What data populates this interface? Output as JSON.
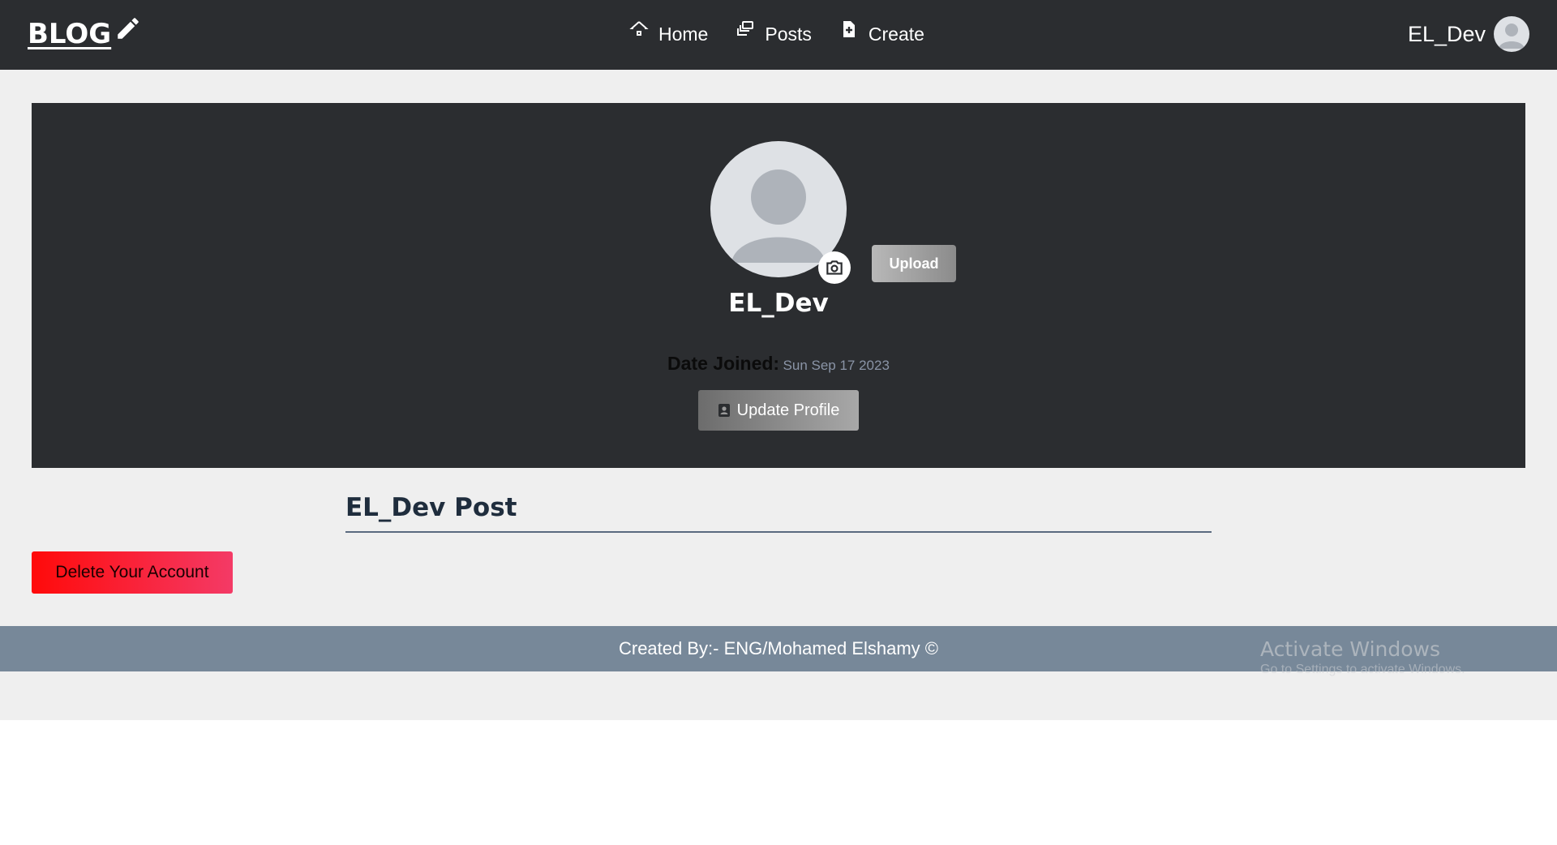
{
  "navbar": {
    "brand_label": "BLOG",
    "brand_icon": "pencil-icon",
    "links": [
      {
        "label": "Home",
        "icon": "home-icon"
      },
      {
        "label": "Posts",
        "icon": "posts-icon"
      },
      {
        "label": "Create",
        "icon": "create-file-icon"
      }
    ],
    "user_name": "EL_Dev",
    "user_avatar_icon": "user-avatar-icon"
  },
  "profile": {
    "name": "EL_Dev",
    "avatar_icon": "user-avatar-icon",
    "camera_icon": "camera-icon",
    "upload_label": "Upload",
    "date_joined_label": "Date Joined:",
    "date_joined_value": "Sun Sep 17 2023",
    "update_label": "Update Profile",
    "update_icon": "profile-card-icon"
  },
  "posts": {
    "title": "EL_Dev Post"
  },
  "account": {
    "delete_label": "Delete Your Account"
  },
  "footer": {
    "text": "Created By:- ENG/Mohamed Elshamy ©"
  },
  "watermark": {
    "title": "Activate Windows",
    "subtitle": "Go to Settings to activate Windows."
  },
  "colors": {
    "navbar_bg": "#2b2d30",
    "page_bg": "#efefef",
    "footer_bg": "#778899",
    "delete_red": "#ff0a0a",
    "avatar_bg": "#dee1e5"
  }
}
